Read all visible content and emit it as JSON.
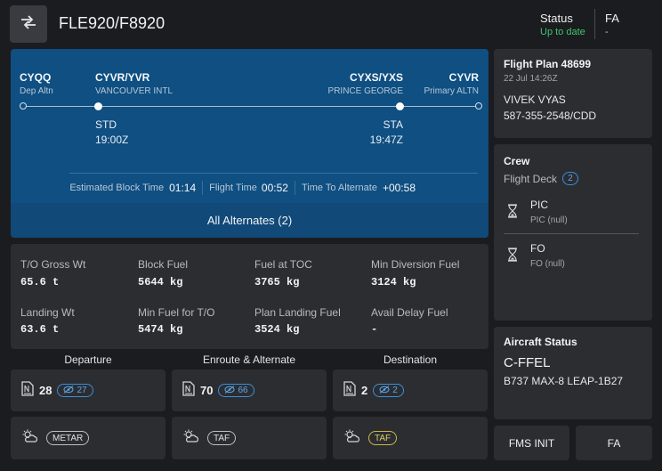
{
  "header": {
    "app_icon": "swap-arrows-icon",
    "flight_id": "FLE920/F8920",
    "status_label": "Status",
    "status_value": "Up to date",
    "role_label": "FA",
    "role_value": "-",
    "status_color": "#3ec46d"
  },
  "route": {
    "dep_altn": {
      "code": "CYQQ",
      "name": "Dep Altn"
    },
    "origin": {
      "code": "CYVR/YVR",
      "name": "VANCOUVER INTL",
      "time_label": "STD",
      "time": "19:00Z"
    },
    "destination": {
      "code": "CYXS/YXS",
      "name": "PRINCE GEORGE",
      "time_label": "STA",
      "time": "19:47Z"
    },
    "primary_altn": {
      "code": "CYVR",
      "name": "Primary ALTN"
    },
    "stats": [
      {
        "label": "Estimated Block Time",
        "value": "01:14"
      },
      {
        "label": "Flight Time",
        "value": "00:52"
      },
      {
        "label": "Time To Alternate",
        "value": "+00:58"
      }
    ],
    "alternates_button": "All Alternates (2)"
  },
  "weights": [
    {
      "label": "T/O Gross Wt",
      "value": "65.6 t"
    },
    {
      "label": "Block Fuel",
      "value": "5644 kg"
    },
    {
      "label": "Fuel at TOC",
      "value": "3765 kg"
    },
    {
      "label": "Min Diversion Fuel",
      "value": "3124 kg"
    },
    {
      "label": "Landing Wt",
      "value": "63.6 t"
    },
    {
      "label": "Min Fuel for T/O",
      "value": "5474 kg"
    },
    {
      "label": "Plan Landing Fuel",
      "value": "3524 kg"
    },
    {
      "label": "Avail Delay Fuel",
      "value": "-"
    }
  ],
  "briefing": {
    "columns": [
      {
        "title": "Departure",
        "notams": "28",
        "hidden": "27",
        "weather": "METAR",
        "weather_style": "normal"
      },
      {
        "title": "Enroute & Alternate",
        "notams": "70",
        "hidden": "66",
        "weather": "TAF",
        "weather_style": "normal"
      },
      {
        "title": "Destination",
        "notams": "2",
        "hidden": "2",
        "weather": "TAF",
        "weather_style": "warning"
      }
    ],
    "notam_icon": "document-icon",
    "hidden_icon": "eye-off-icon",
    "weather_icon": "partly-cloudy-icon"
  },
  "flight_plan": {
    "title": "Flight Plan 48699",
    "date": "22 Jul 14:26Z",
    "dispatcher": "VIVEK VYAS",
    "phone": "587-355-2548/CDD"
  },
  "crew": {
    "title": "Crew",
    "section": "Flight Deck",
    "count": "2",
    "members": [
      {
        "role": "PIC",
        "name": "PIC (null)"
      },
      {
        "role": "FO",
        "name": "FO (null)"
      }
    ],
    "member_icon": "hourglass-icon"
  },
  "aircraft": {
    "title": "Aircraft Status",
    "registration": "C-FFEL",
    "type": "B737 MAX-8 LEAP-1B27"
  },
  "buttons": {
    "fms_init": "FMS INIT",
    "fa": "FA"
  }
}
